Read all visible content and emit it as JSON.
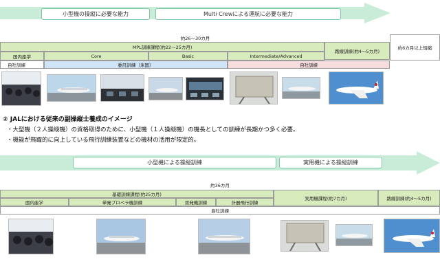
{
  "top": {
    "arrow": {
      "phase1": "小型機の操縦に必要な能力",
      "phase2": "Multi Crewによる運航に必要な能力"
    },
    "total_period": "約26～30カ月",
    "mpl_program": "MPL訓練課程(約22～25カ月)",
    "route_training": "路線訓練(約4～5カ月)",
    "side_period": "約6カ月以上短縮",
    "stages": {
      "domestic": "国内座学",
      "core": "Core",
      "basic": "Basic",
      "intermediate": "Intermediate/Advanced"
    },
    "training": {
      "inhouse1": "自社訓練",
      "outsourced": "委託訓練（米国）",
      "inhouse2": "自社訓練"
    }
  },
  "section2": {
    "heading": "② JALにおける従来の副操縦士養成のイメージ",
    "bullet1": "・大型機（２人操縦機）の資格取得のために、小型機（１人操縦機）の機長としての訓練が長期かつ多く必要。",
    "bullet2": "・機能が飛躍的に向上している飛行訓練装置などの機材の活用が限定的。"
  },
  "bottom": {
    "arrow": {
      "phase1": "小型機による操縦訓練",
      "phase2": "実用機による操縦訓練"
    },
    "total_period": "約36カ月",
    "basic_program": "基礎訓練課程(約25カ月)",
    "type_program": "実用機課程(約7カ月)",
    "route_training": "路線訓練(約4～5カ月)",
    "stages": {
      "domestic": "国内座学",
      "single": "単発プロペラ機訓練",
      "twin": "双発機訓練",
      "instrument": "計器飛行訓練"
    },
    "training": {
      "inhouse": "自社訓練"
    }
  },
  "colors": {
    "arrow": "#c8ecd8",
    "green": "#d8ebbc",
    "blue": "#cfe4f6",
    "pink": "#f6dcdc"
  },
  "icons": [
    "classroom-photo",
    "small-plane-photo",
    "cockpit-photo",
    "jet-photo",
    "simulator-photo",
    "jal-airliner-photo"
  ]
}
